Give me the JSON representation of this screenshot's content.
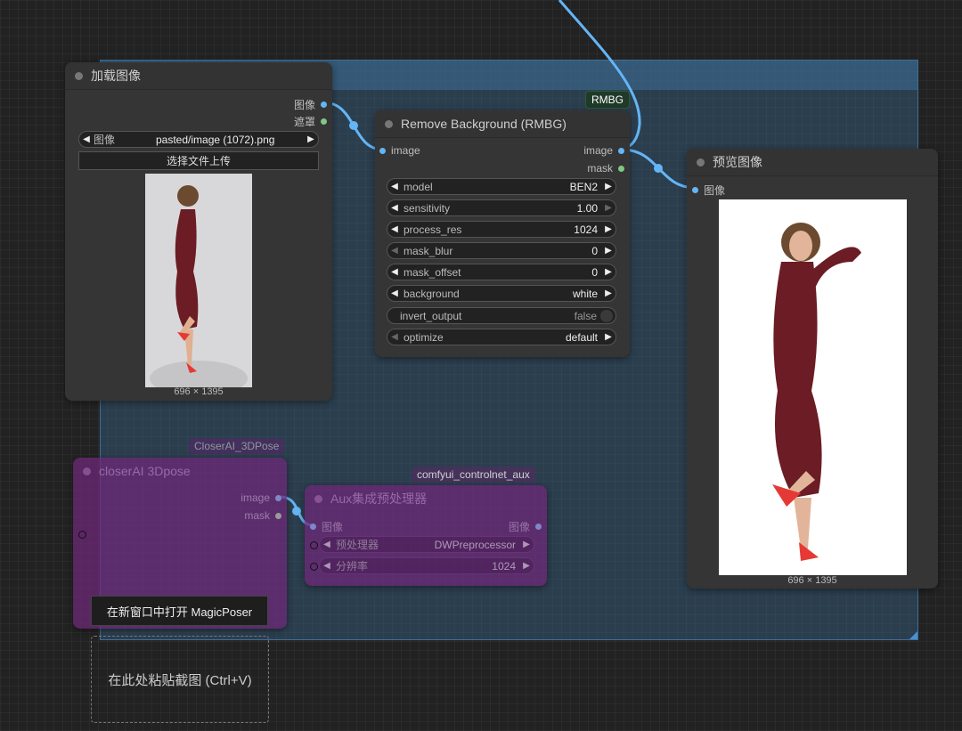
{
  "load_image_node": {
    "title": "加载图像",
    "outputs": [
      "图像",
      "遮罩"
    ],
    "image_widget": {
      "label": "图像",
      "value": "pasted/image (1072).png"
    },
    "upload_button": "选择文件上传",
    "dimensions": "696 × 1395"
  },
  "rmbg_node": {
    "badge": "RMBG",
    "title": "Remove Background (RMBG)",
    "input": "image",
    "outputs": [
      "image",
      "mask"
    ],
    "widgets": [
      {
        "label": "model",
        "value": "BEN2"
      },
      {
        "label": "sensitivity",
        "value": "1.00"
      },
      {
        "label": "process_res",
        "value": "1024"
      },
      {
        "label": "mask_blur",
        "value": "0"
      },
      {
        "label": "mask_offset",
        "value": "0"
      },
      {
        "label": "background",
        "value": "white"
      },
      {
        "label": "invert_output",
        "value": "false"
      },
      {
        "label": "optimize",
        "value": "default"
      }
    ]
  },
  "preview_node": {
    "title": "预览图像",
    "input": "图像",
    "dimensions": "696 × 1395"
  },
  "closerai_node": {
    "badge": "CloserAI_3DPose",
    "title": "closerAI 3Dpose",
    "outputs": [
      "image",
      "mask"
    ],
    "button": "在新窗口中打开 MagicPoser"
  },
  "aux_node": {
    "badge": "comfyui_controlnet_aux",
    "title": "Aux集成预处理器",
    "input": "图像",
    "output": "图像",
    "widgets": [
      {
        "label": "预处理器",
        "value": "DWPreprocessor"
      },
      {
        "label": "分辨率",
        "value": "1024"
      }
    ]
  },
  "paste_zone": {
    "label": "在此处粘贴截图 (Ctrl+V)"
  },
  "colors": {
    "image_link": "#64b5f6",
    "mask_link": "#81c784",
    "group": "#3f6f9a"
  }
}
